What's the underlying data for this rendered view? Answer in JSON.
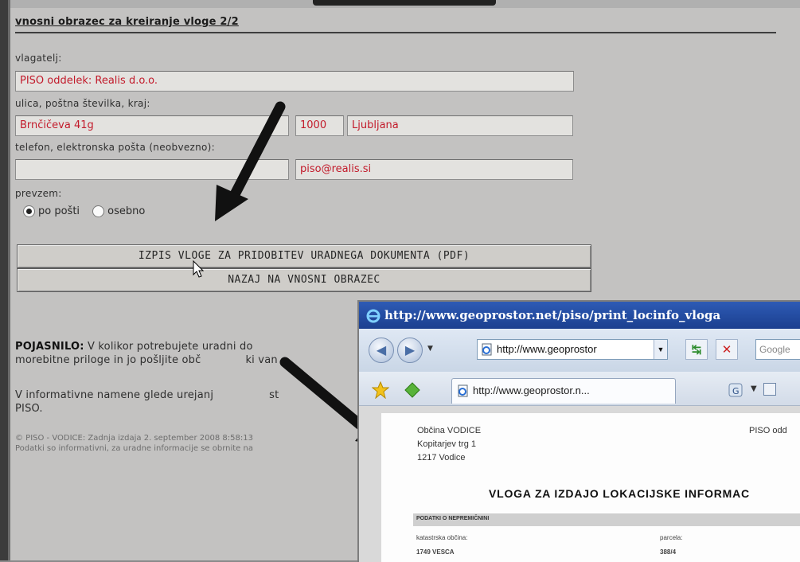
{
  "form": {
    "title": "vnosni obrazec za kreiranje vloge 2/2",
    "applicant_label": "vlagatelj:",
    "applicant_value": "PISO oddelek: Realis d.o.o.",
    "address_label": "ulica, poštna številka, kraj:",
    "street_value": "Brnčičeva 41g",
    "postal_value": "1000",
    "city_value": "Ljubljana",
    "contact_label": "telefon, elektronska pošta (neobvezno):",
    "phone_value": "",
    "email_value": "piso@realis.si",
    "pickup_label": "prevzem:",
    "pickup_options": [
      "po pošti",
      "osebno"
    ],
    "pickup_selected": "po pošti",
    "print_button": "IZPIS VLOGE ZA PRIDOBITEV URADNEGA DOKUMENTA (PDF)",
    "back_button": "NAZAJ NA VNOSNI OBRAZEC",
    "note_label": "POJASNILO:",
    "note_line1": " V kolikor potrebujete uradni do",
    "note_line1_tail": "",
    "note_line2": "morebitne priloge in jo pošljite obč",
    "note_line2_tail": "ki van",
    "info_line1": "V informativne namene glede urejanj",
    "info_line1_tail": "st",
    "info_line2": "PISO.",
    "footer_line1": "© PISO - VODICE: Zadnja izdaja 2. september 2008 8:58:13",
    "footer_line2": "Podatki so informativni, za uradne informacije se obrnite na"
  },
  "browser": {
    "title": "http://www.geoprostor.net/piso/print_locinfo_vloga",
    "address": "http://www.geoprostor",
    "search_placeholder": "Google",
    "tab_label": "http://www.geoprostor.n...",
    "icons": [
      "ie-logo-icon",
      "back-icon",
      "forward-icon",
      "refresh-icon",
      "stop-icon",
      "favorites-star-icon",
      "add-favorite-icon",
      "home-icon"
    ]
  },
  "document": {
    "municipality": "Občina VODICE",
    "street": "Kopitarjev trg 1",
    "city": "1217 Vodice",
    "header_right": "PISO odd",
    "title": "VLOGA ZA IZDAJO LOKACIJSKE INFORMAC",
    "section_band": "PODATKI O NEPREMIČNINI",
    "col1_label": "katastrska občina:",
    "col1_value": "1749 VESCA",
    "col2_label": "parcela:",
    "col2_value": "388/4"
  },
  "colors": {
    "panel_bg": "#c3c2c1",
    "field_bg": "#e3e2df",
    "field_text": "#c21a2a",
    "ie_title": "#1b3f8f"
  }
}
